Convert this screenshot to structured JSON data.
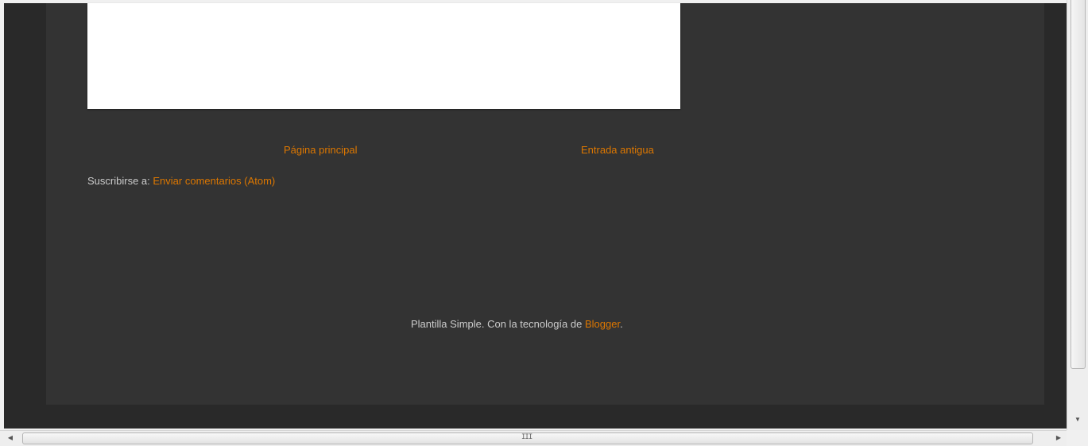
{
  "pager": {
    "home_label": "Página principal",
    "older_label": "Entrada antigua"
  },
  "subscribe": {
    "prefix": "Suscribirse a:",
    "link_label": "Enviar comentarios (Atom)"
  },
  "attribution": {
    "text": "Plantilla Simple. Con la tecnología de",
    "link_label": "Blogger",
    "suffix": "."
  },
  "scrollbars": {
    "horizontal_grip": "III"
  },
  "colors": {
    "link": "#dd7700",
    "text": "#cccccc",
    "page_background": "#292929",
    "content_background": "#333333"
  }
}
